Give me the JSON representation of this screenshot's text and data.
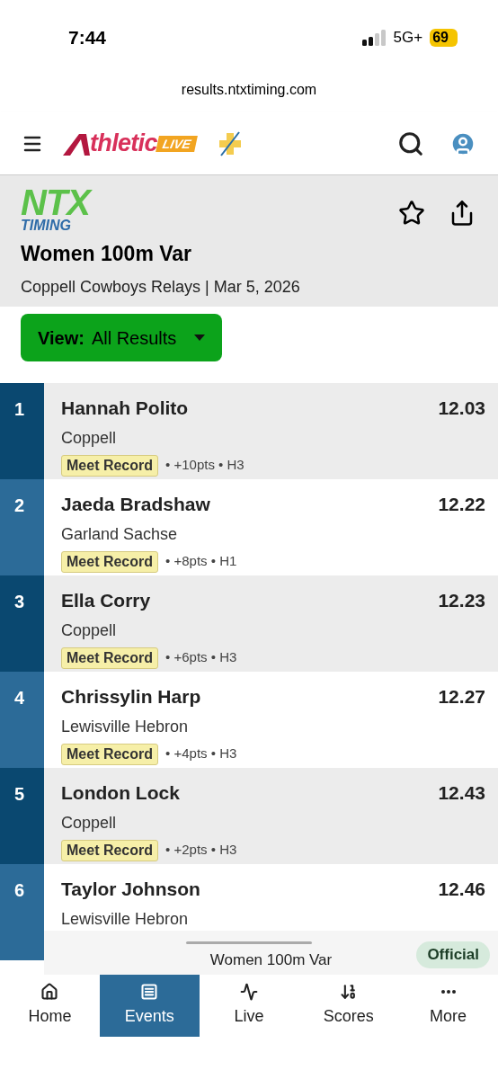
{
  "status_bar": {
    "time": "7:44",
    "network": "5G+",
    "battery": "69"
  },
  "url_bar": {
    "url": "results.ntxtiming.com"
  },
  "header": {
    "logo_word": "thletic",
    "logo_badge": "LIVE"
  },
  "event": {
    "logo_top": "NTX",
    "logo_bottom": "TIMING",
    "title": "Women 100m Var",
    "subtitle": "Coppell Cowboys Relays | Mar 5, 2026"
  },
  "view_button": {
    "label": "View:",
    "value": "All Results"
  },
  "results": [
    {
      "rank": "1",
      "name": "Hannah Polito",
      "team": "Coppell",
      "badge": "Meet Record",
      "meta": "• +10pts • H3",
      "time": "12.03"
    },
    {
      "rank": "2",
      "name": "Jaeda Bradshaw",
      "team": "Garland Sachse",
      "badge": "Meet Record",
      "meta": "• +8pts • H1",
      "time": "12.22"
    },
    {
      "rank": "3",
      "name": "Ella Corry",
      "team": "Coppell",
      "badge": "Meet Record",
      "meta": "• +6pts • H3",
      "time": "12.23"
    },
    {
      "rank": "4",
      "name": "Chrissylin Harp",
      "team": "Lewisville Hebron",
      "badge": "Meet Record",
      "meta": "• +4pts • H3",
      "time": "12.27"
    },
    {
      "rank": "5",
      "name": "London Lock",
      "team": "Coppell",
      "badge": "Meet Record",
      "meta": "• +2pts • H3",
      "time": "12.43"
    },
    {
      "rank": "6",
      "name": "Taylor Johnson",
      "team": "Lewisville Hebron",
      "time": "12.46"
    }
  ],
  "footer_bar": {
    "title": "Women 100m Var",
    "status": "Official"
  },
  "nav": [
    {
      "kind": "home",
      "label": "Home",
      "selected": false
    },
    {
      "kind": "events",
      "label": "Events",
      "selected": true
    },
    {
      "kind": "live",
      "label": "Live",
      "selected": false
    },
    {
      "kind": "scores",
      "label": "Scores",
      "selected": false
    },
    {
      "kind": "more",
      "label": "More",
      "selected": false
    }
  ]
}
